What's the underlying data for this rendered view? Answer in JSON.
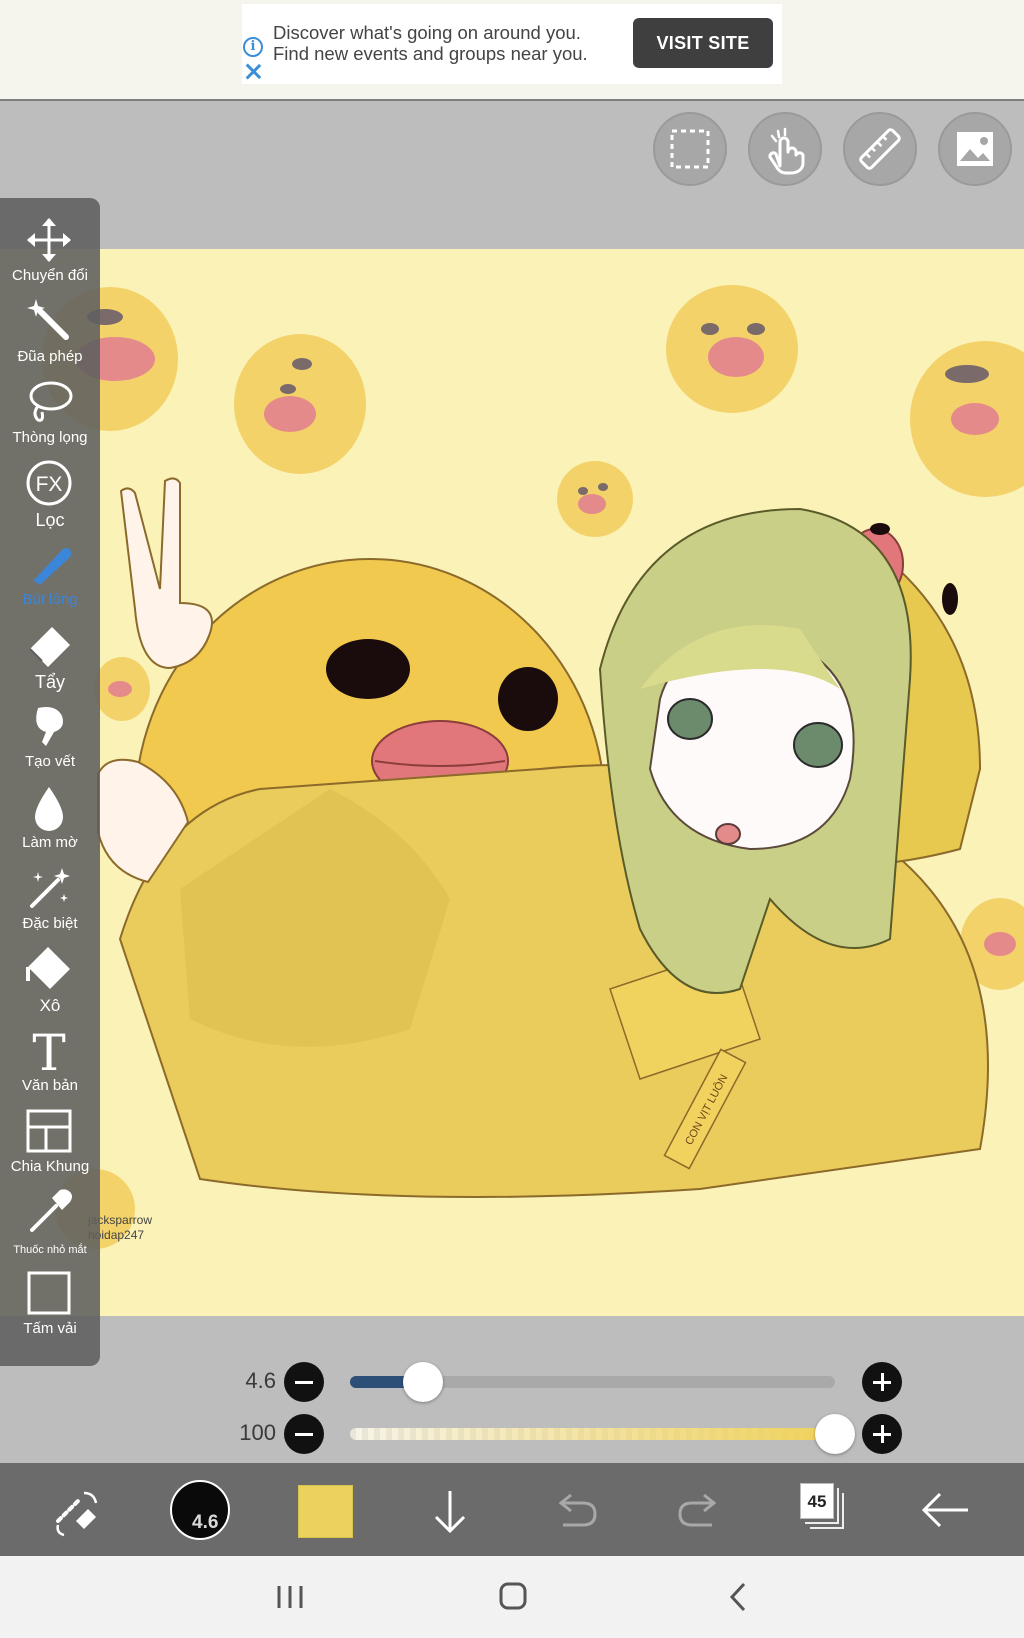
{
  "ad": {
    "line1": "Discover what's going on around you.",
    "line2": "Find new events and groups near you.",
    "button": "VISIT SITE",
    "info_icon": "info-icon",
    "close_icon": "close-icon"
  },
  "top_tools": [
    {
      "name": "selection-icon"
    },
    {
      "name": "hand-gesture-icon"
    },
    {
      "name": "ruler-icon"
    },
    {
      "name": "image-icon"
    }
  ],
  "palette": {
    "tools": [
      {
        "label": "Chuyển đổi",
        "icon": "move-icon"
      },
      {
        "label": "Đũa phép",
        "icon": "magic-wand-icon"
      },
      {
        "label": "Thòng lọng",
        "icon": "lasso-icon"
      },
      {
        "label": "Lọc",
        "icon": "fx-filter-icon",
        "icon_text": "FX"
      },
      {
        "label": "Bút lông",
        "icon": "brush-icon",
        "active": true
      },
      {
        "label": "Tẩy",
        "icon": "eraser-icon"
      },
      {
        "label": "Tạo vết",
        "icon": "smudge-icon"
      },
      {
        "label": "Làm mờ",
        "icon": "blur-drop-icon"
      },
      {
        "label": "Đặc biệt",
        "icon": "special-pen-icon"
      },
      {
        "label": "Xô",
        "icon": "bucket-icon"
      },
      {
        "label": "Văn bản",
        "icon": "text-icon",
        "icon_text": "T"
      },
      {
        "label": "Chia Khung",
        "icon": "frame-divider-icon"
      },
      {
        "label": "Thuốc nhỏ mắt",
        "icon": "eyedropper-icon"
      },
      {
        "label": "Tấm vải",
        "icon": "canvas-icon"
      }
    ]
  },
  "canvas": {
    "background": "#fbf2b7",
    "watermark_line1": "jacksparrow",
    "watermark_line2": "hoidap247",
    "tag_text": "CON VỊT LUÔN"
  },
  "sliders": {
    "size": {
      "value": "4.6",
      "fraction": 0.15
    },
    "opacity": {
      "value": "100",
      "fraction": 1.0
    }
  },
  "bottom_bar": {
    "brush_size": "4.6",
    "color": "#ebd25f",
    "layer_count": "45",
    "icons": [
      "swap-tool-icon",
      "brush-size-icon",
      "color-swatch",
      "download-icon",
      "undo-icon",
      "redo-icon",
      "layers-icon",
      "back-arrow-icon"
    ]
  },
  "system_nav": [
    "recent-apps-icon",
    "home-icon",
    "back-icon"
  ]
}
